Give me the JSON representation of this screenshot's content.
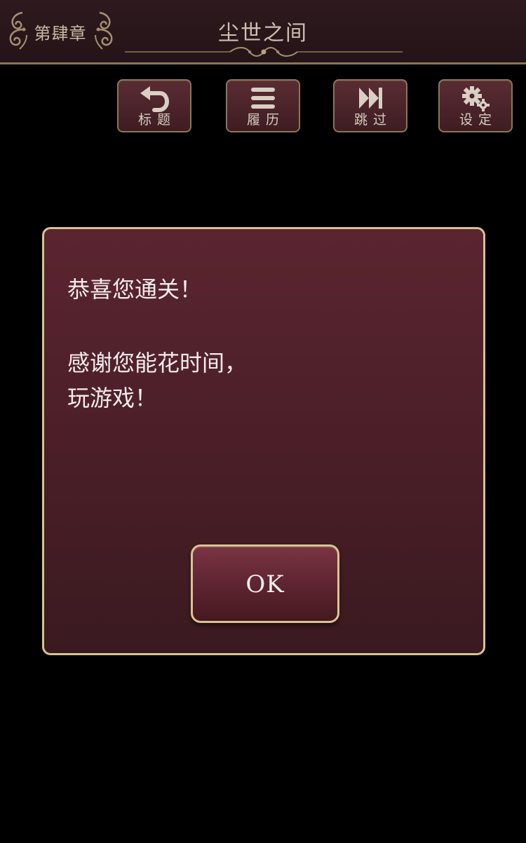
{
  "header": {
    "chapter": "第肆章",
    "title": "尘世之间"
  },
  "toolbar": {
    "title_label": "标题",
    "history_label": "履历",
    "skip_label": "跳过",
    "settings_label": "设定"
  },
  "dialog": {
    "line1": "恭喜您通关！",
    "line2": "感谢您能花时间，",
    "line3": "玩游戏！",
    "ok_label": "OK"
  },
  "colors": {
    "gold_border": "#d8c290",
    "dialog_bg": "#4a1e27",
    "header_bg": "#2e1a1e",
    "text": "#f4ecec"
  },
  "icons": {
    "title": "undo-arrow-icon",
    "history": "menu-lines-icon",
    "skip": "fast-forward-icon",
    "settings": "gears-icon"
  }
}
